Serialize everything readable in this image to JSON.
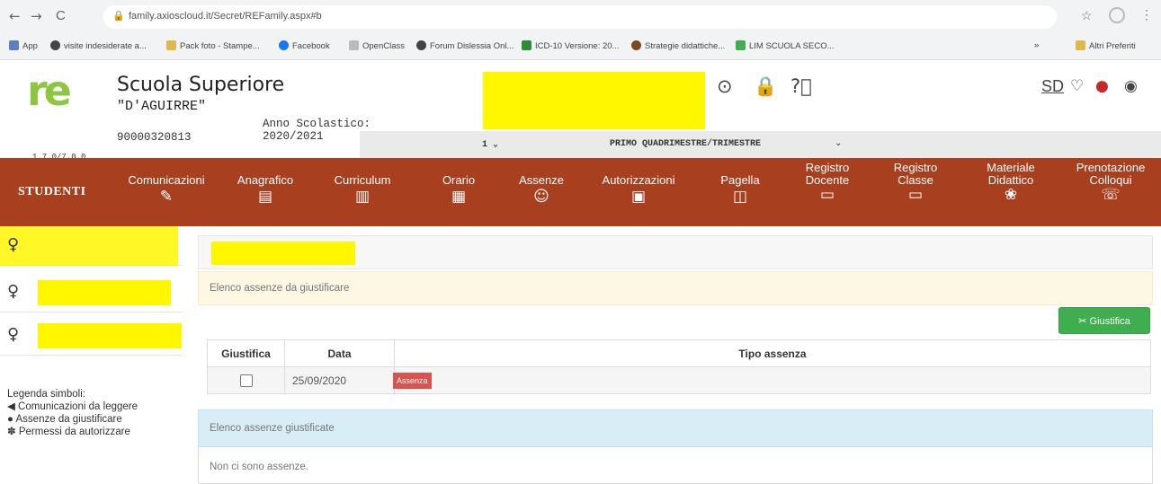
{
  "browser": {
    "back": "←",
    "forward": "→",
    "reload": "C",
    "url": "family.axioscloud.it/Secret/REFamily.aspx#b",
    "bookmarks": [
      {
        "label": "App",
        "color": "#5f7fbf"
      },
      {
        "label": "visite indesiderate a...",
        "color": "#444444"
      },
      {
        "label": "Pack foto - Stampe...",
        "color": "#e0b84a"
      },
      {
        "label": "Facebook",
        "color": "#1877f2"
      },
      {
        "label": "OpenClass",
        "color": "#8a8a8a"
      },
      {
        "label": "Forum Dislessia Onl...",
        "color": "#444444"
      },
      {
        "label": "ICD-10 Versione: 20...",
        "color": "#2e8b3a"
      },
      {
        "label": "Strategie didattiche...",
        "color": "#7a4a20"
      },
      {
        "label": "LIM SCUOLA SECO...",
        "color": "#3fae4f"
      }
    ],
    "more_bookmarks": "»",
    "other_bookmarks": "Altri Preferiti"
  },
  "header": {
    "logo_text": "re",
    "version": "1.7.0/7.0.0",
    "school_name": "Scuola Superiore",
    "school_sub": "\"D'AGUIRRE\"",
    "anno_label": "Anno Scolastico:",
    "anno_value": "2020/2021",
    "code": "90000320813",
    "brand_sd": "SD"
  },
  "period": {
    "left": "1 ⌄",
    "text": "PRIMO QUADRIMESTRE/TRIMESTRE",
    "chevron": "⌄"
  },
  "nav": {
    "section": "STUDENTI",
    "items": [
      {
        "line1": "Comunicazioni",
        "line2": "",
        "icon": "megaphone-icon"
      },
      {
        "line1": "Anagrafico",
        "line2": "",
        "icon": "id-card-icon"
      },
      {
        "line1": "Curriculum",
        "line2": "",
        "icon": "document-icon"
      },
      {
        "line1": "Orario",
        "line2": "",
        "icon": "calendar-icon"
      },
      {
        "line1": "Assenze",
        "line2": "",
        "icon": "smiley-icon"
      },
      {
        "line1": "Autorizzazioni",
        "line2": "",
        "icon": "calendar-star-icon"
      },
      {
        "line1": "Pagella",
        "line2": "",
        "icon": "report-icon"
      },
      {
        "line1": "Registro",
        "line2": "Docente",
        "icon": "register-icon"
      },
      {
        "line1": "Registro",
        "line2": "Classe",
        "icon": "register-icon"
      },
      {
        "line1": "Materiale",
        "line2": "Didattico",
        "icon": "materials-icon"
      },
      {
        "line1": "Prenotazione",
        "line2": "Colloqui",
        "icon": "chat-icon"
      }
    ]
  },
  "sidebar": {
    "student_symbol": "♀",
    "legend_title": "Legenda simboli:",
    "legend": [
      {
        "icon": "megaphone-icon",
        "text": "Comunicazioni da leggere"
      },
      {
        "icon": "absence-icon",
        "text": "Assenze da giustificare"
      },
      {
        "icon": "permission-icon",
        "text": "Permessi da autorizzare"
      }
    ]
  },
  "main": {
    "panel1_title": "Elenco assenze da giustificare",
    "justify_button": "✂ Giustifica",
    "table_headers": [
      "Giustifica",
      "Data",
      "Tipo assenza"
    ],
    "rows": [
      {
        "date": "25/09/2020",
        "type": "Assenza"
      }
    ],
    "panel2_title": "Elenco assenze giustificate",
    "panel2_empty": "Non ci sono assenze."
  },
  "colors": {
    "nav_bg": "#a8401f",
    "logo_green": "#8dc63f",
    "highlight": "#fff700",
    "button_green": "#3fae4f",
    "badge_red": "#d9534f"
  }
}
